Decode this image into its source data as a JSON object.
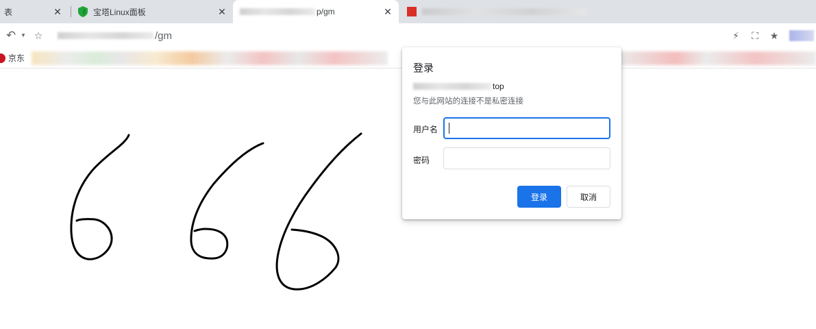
{
  "browser": {
    "tabs": [
      {
        "title": "表",
        "close": "✕"
      },
      {
        "title": "宝塔Linux面板",
        "close": "✕"
      },
      {
        "title": "p/gm",
        "close": "✕"
      },
      {
        "title": "",
        "close": ""
      }
    ],
    "address_bar": {
      "url_visible": "/gm"
    },
    "bookmarks": [
      {
        "label": "京东"
      }
    ]
  },
  "login_dialog": {
    "title": "登录",
    "origin_suffix": "top",
    "privacy_note": "您与此网站的连接不是私密连接",
    "username_label": "用户名",
    "username_value": "",
    "password_label": "密码",
    "password_value": "",
    "submit_label": "登录",
    "cancel_label": "取消"
  },
  "colors": {
    "accent": "#1a73e8",
    "tabstrip": "#dee1e6",
    "stroke": "#000000"
  },
  "icons": [
    "shield-icon",
    "close-icon",
    "back-icon",
    "dropdown-icon",
    "star-icon",
    "lightning-icon",
    "screenshot-icon",
    "bookmark-icon",
    "jd-icon"
  ]
}
